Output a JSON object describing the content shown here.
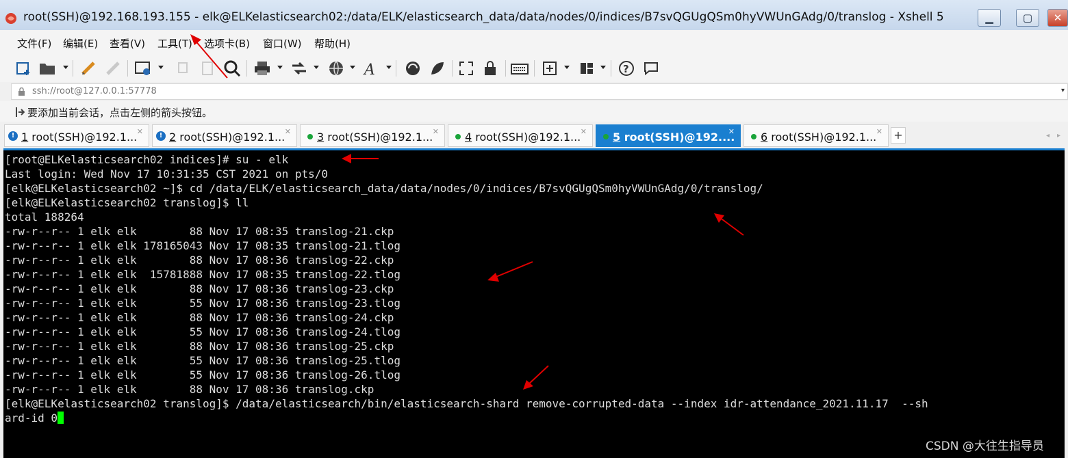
{
  "window": {
    "title": "root(SSH)@192.168.193.155 - elk@ELKelasticsearch02:/data/ELK/elasticsearch_data/data/nodes/0/indices/B7svQGUgQSm0hyVWUnGAdg/0/translog - Xshell 5",
    "minimize": "▁",
    "maximize": "▢",
    "close": "✕"
  },
  "menu": [
    "文件(F)",
    "编辑(E)",
    "查看(V)",
    "工具(T)",
    "选项卡(B)",
    "窗口(W)",
    "帮助(H)"
  ],
  "address": {
    "value": "ssh://root@127.0.0.1:57778"
  },
  "hint": {
    "text": "要添加当前会话，点击左侧的箭头按钮。"
  },
  "tabs": [
    {
      "num": "1",
      "label": "root(SSH)@192.1...",
      "status": "warn",
      "active": false
    },
    {
      "num": "2",
      "label": "root(SSH)@192.1...",
      "status": "warn",
      "active": false
    },
    {
      "num": "3",
      "label": "root(SSH)@192.1...",
      "status": "ok",
      "active": false
    },
    {
      "num": "4",
      "label": "root(SSH)@192.1...",
      "status": "ok",
      "active": false
    },
    {
      "num": "5",
      "label": "root(SSH)@192....",
      "status": "ok",
      "active": true
    },
    {
      "num": "6",
      "label": "root(SSH)@192.1...",
      "status": "ok",
      "active": false
    }
  ],
  "tab_add": "+",
  "tab_nav": {
    "prev": "◂",
    "next": "▸"
  },
  "terminal": {
    "lines": [
      "[root@ELKelasticsearch02 indices]# su - elk",
      "Last login: Wed Nov 17 10:31:35 CST 2021 on pts/0",
      "[elk@ELKelasticsearch02 ~]$ cd /data/ELK/elasticsearch_data/data/nodes/0/indices/B7svQGUgQSm0hyVWUnGAdg/0/translog/",
      "[elk@ELKelasticsearch02 translog]$ ll",
      "total 188264",
      "-rw-r--r-- 1 elk elk        88 Nov 17 08:35 translog-21.ckp",
      "-rw-r--r-- 1 elk elk 178165043 Nov 17 08:35 translog-21.tlog",
      "-rw-r--r-- 1 elk elk        88 Nov 17 08:36 translog-22.ckp",
      "-rw-r--r-- 1 elk elk  15781888 Nov 17 08:35 translog-22.tlog",
      "-rw-r--r-- 1 elk elk        88 Nov 17 08:36 translog-23.ckp",
      "-rw-r--r-- 1 elk elk        55 Nov 17 08:36 translog-23.tlog",
      "-rw-r--r-- 1 elk elk        88 Nov 17 08:36 translog-24.ckp",
      "-rw-r--r-- 1 elk elk        55 Nov 17 08:36 translog-24.tlog",
      "-rw-r--r-- 1 elk elk        88 Nov 17 08:36 translog-25.ckp",
      "-rw-r--r-- 1 elk elk        55 Nov 17 08:36 translog-25.tlog",
      "-rw-r--r-- 1 elk elk        55 Nov 17 08:36 translog-26.tlog",
      "-rw-r--r-- 1 elk elk        88 Nov 17 08:36 translog.ckp",
      "[elk@ELKelasticsearch02 translog]$ /data/elasticsearch/bin/elasticsearch-shard remove-corrupted-data --index idr-attendance_2021.11.17  --sh",
      "ard-id 0"
    ]
  },
  "watermark": "CSDN @大往生指导员",
  "colors": {
    "accent": "#1a7fd0",
    "terminal_bg": "#000000",
    "cursor": "#00ff00",
    "annotation": "#e00000"
  }
}
